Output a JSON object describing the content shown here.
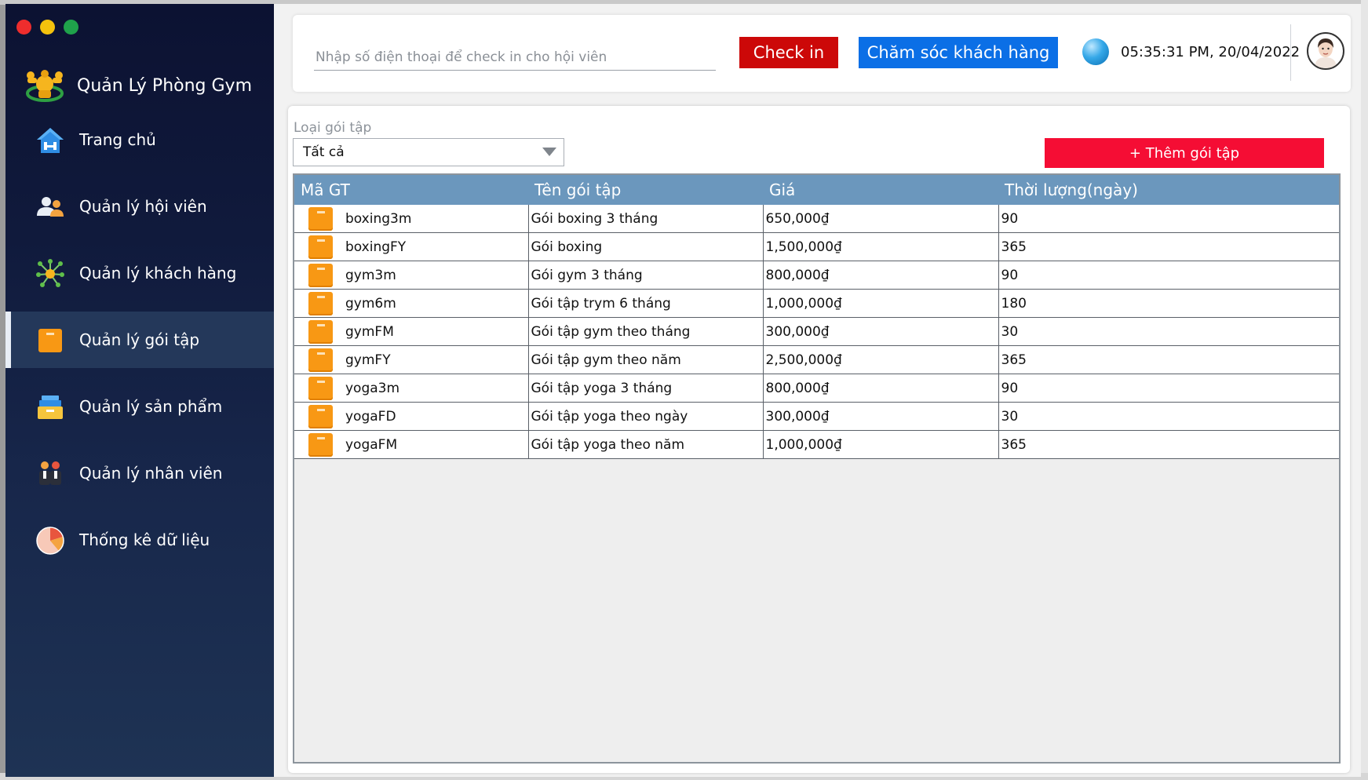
{
  "app": {
    "title": "Quản Lý Phòng Gym"
  },
  "sidebar": {
    "items": [
      {
        "label": "Trang chủ",
        "icon": "home-icon",
        "active": false
      },
      {
        "label": "Quản lý hội viên",
        "icon": "members-icon",
        "active": false
      },
      {
        "label": "Quản lý khách hàng",
        "icon": "customers-network-icon",
        "active": false
      },
      {
        "label": "Quản lý gói tập",
        "icon": "package-icon",
        "active": true
      },
      {
        "label": "Quản lý sản phẩm",
        "icon": "products-icon",
        "active": false
      },
      {
        "label": "Quản lý nhân viên",
        "icon": "staff-icon",
        "active": false
      },
      {
        "label": "Thống kê dữ liệu",
        "icon": "pie-chart-icon",
        "active": false
      }
    ]
  },
  "topbar": {
    "phone_placeholder": "Nhập số điện thoại để check in cho hội viên",
    "phone_value": "",
    "checkin_label": "Check in",
    "care_label": "Chăm sóc khách hàng",
    "datetime": "05:35:31 PM, 20/04/2022"
  },
  "filter": {
    "label": "Loại gói tập",
    "selected": "Tất cả"
  },
  "add_button": "+ Thêm gói tập",
  "table": {
    "columns": [
      "Mã GT",
      "Tên gói tập",
      "Giá",
      "Thời lượng(ngày)"
    ],
    "rows": [
      {
        "code": "boxing3m",
        "name": "Gói boxing 3 tháng",
        "price": "650,000₫",
        "duration": "90"
      },
      {
        "code": "boxingFY",
        "name": "Gói boxing",
        "price": "1,500,000₫",
        "duration": "365"
      },
      {
        "code": "gym3m",
        "name": "Gói gym 3 tháng",
        "price": "800,000₫",
        "duration": "90"
      },
      {
        "code": "gym6m",
        "name": "Gói tập trym 6 tháng",
        "price": "1,000,000₫",
        "duration": "180"
      },
      {
        "code": "gymFM",
        "name": "Gói tập gym theo tháng",
        "price": "300,000₫",
        "duration": "30"
      },
      {
        "code": "gymFY",
        "name": "Gói tập gym theo năm",
        "price": "2,500,000₫",
        "duration": "365"
      },
      {
        "code": "yoga3m",
        "name": "Gói tập yoga 3 tháng",
        "price": "800,000₫",
        "duration": "90"
      },
      {
        "code": "yogaFD",
        "name": "Gói tập yoga theo ngày",
        "price": "300,000₫",
        "duration": "30"
      },
      {
        "code": "yogaFM",
        "name": "Gói tập yoga theo năm",
        "price": "1,000,000₫",
        "duration": "365"
      }
    ]
  },
  "colors": {
    "sidebar_top": "#0c1232",
    "sidebar_bottom": "#1e3354",
    "checkin": "#cc0808",
    "care": "#0b6fe6",
    "add": "#f50d34",
    "table_header": "#6b97bd",
    "row_icon": "#f89814"
  }
}
